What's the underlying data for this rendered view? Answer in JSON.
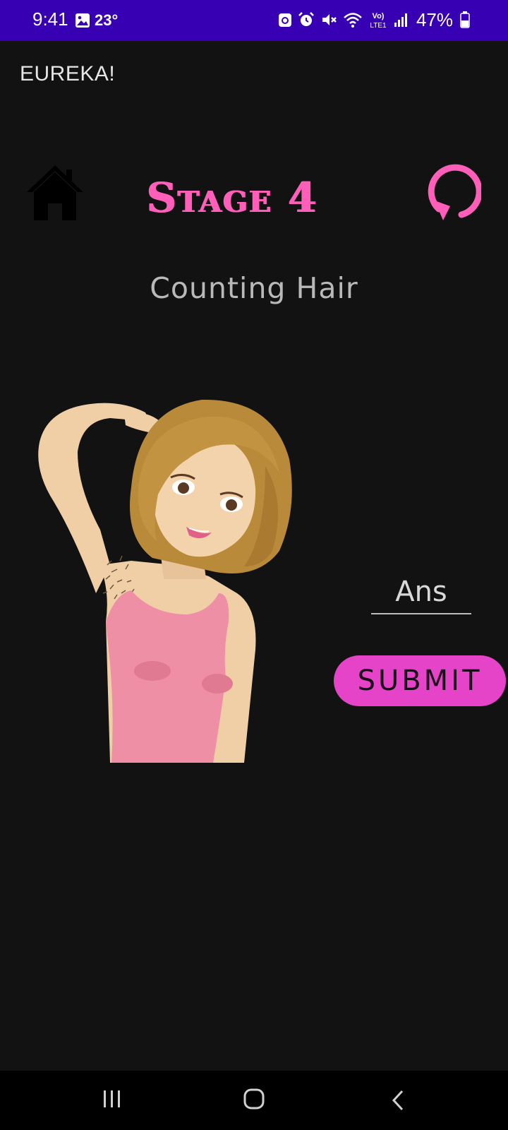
{
  "status_bar": {
    "time": "9:41",
    "temperature": "23°",
    "battery_percent": "47%",
    "icons": [
      "photo-icon",
      "mail-sync-icon",
      "alarm-icon",
      "mute-icon",
      "wifi-icon",
      "volte-icon",
      "signal-icon",
      "battery-icon"
    ],
    "volte_label": "Vo) LTE1"
  },
  "app_bar": {
    "title": "EUREKA!"
  },
  "stage": {
    "title": "Stage 4",
    "subtitle": "Counting Hair",
    "home_icon": "home-icon",
    "restart_icon": "restart-icon"
  },
  "answer": {
    "placeholder": "Ans",
    "value": ""
  },
  "submit": {
    "label": "SUBMIT"
  },
  "nav": {
    "icons": [
      "recents-icon",
      "home-circle-icon",
      "back-icon"
    ]
  },
  "colors": {
    "status_bar": "#3700b3",
    "background": "#121212",
    "stage_title": "#ff5fb8",
    "submit_button": "#e544c8",
    "restart_icon": "#ff5fb8"
  }
}
